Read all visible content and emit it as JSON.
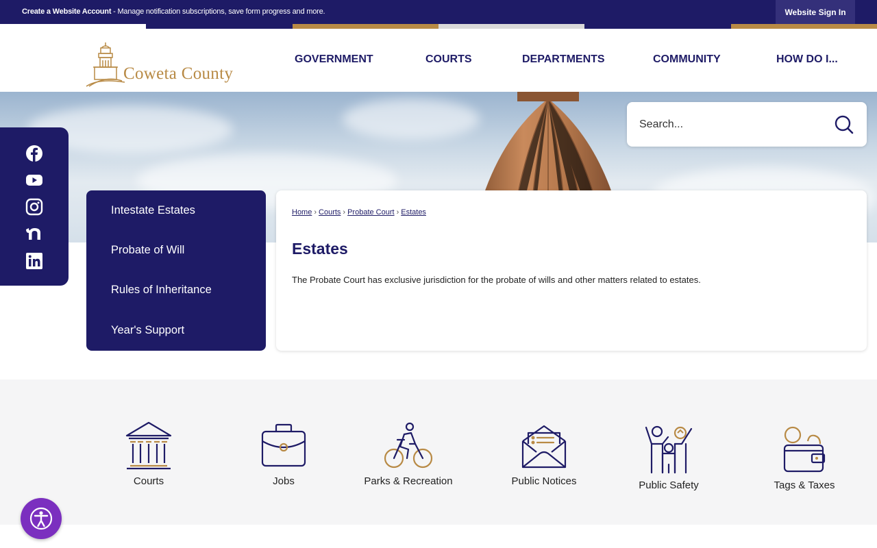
{
  "topbar": {
    "account_link": "Create a Website Account",
    "account_desc": " - Manage notification subscriptions, save form progress and more.",
    "signin": "Website Sign In"
  },
  "colors": {
    "primary": "#1e1b66",
    "accent": "#b88a45",
    "a11y": "#7b2fbf"
  },
  "header": {
    "logo_text": "Coweta County",
    "nav": [
      "GOVERNMENT",
      "COURTS",
      "DEPARTMENTS",
      "COMMUNITY",
      "HOW DO I..."
    ]
  },
  "search": {
    "placeholder": "Search..."
  },
  "social": [
    "facebook-icon",
    "youtube-icon",
    "instagram-icon",
    "nextdoor-icon",
    "linkedin-icon"
  ],
  "sidenav": {
    "items": [
      "Intestate Estates",
      "Probate of Will",
      "Rules of Inheritance",
      "Year's Support"
    ]
  },
  "breadcrumb": [
    "Home",
    "Courts",
    "Probate Court",
    "Estates"
  ],
  "content": {
    "title": "Estates",
    "description": "The Probate Court has exclusive jurisdiction for the probate of wills and other matters related to estates."
  },
  "quicklinks": [
    {
      "label": "Courts",
      "icon": "courthouse-icon"
    },
    {
      "label": "Jobs",
      "icon": "briefcase-icon"
    },
    {
      "label": "Parks & Recreation",
      "icon": "bicycle-icon"
    },
    {
      "label": "Public Notices",
      "icon": "envelope-icon"
    },
    {
      "label": "Public Safety",
      "icon": "family-icon"
    },
    {
      "label": "Tags & Taxes",
      "icon": "wallet-icon"
    }
  ]
}
